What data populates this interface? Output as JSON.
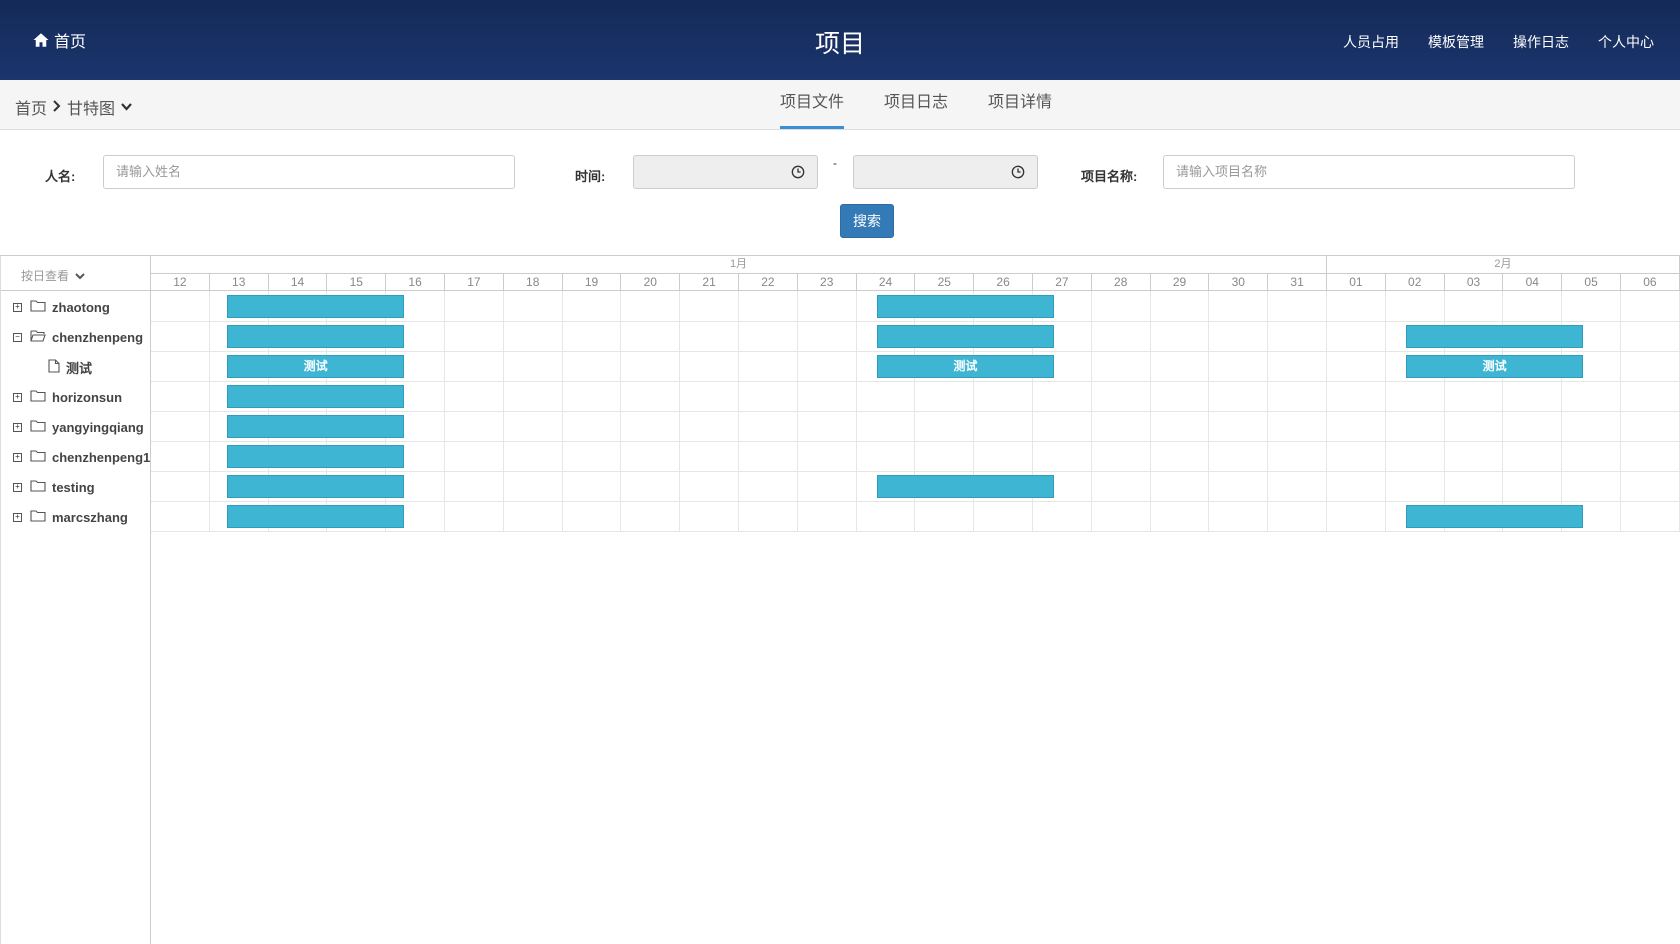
{
  "header": {
    "home_label": "首页",
    "title": "项目",
    "nav": [
      "人员占用",
      "模板管理",
      "操作日志",
      "个人中心"
    ]
  },
  "breadcrumb": {
    "root": "首页",
    "current": "甘特图"
  },
  "tabs": [
    {
      "label": "项目文件",
      "active": true
    },
    {
      "label": "项目日志",
      "active": false
    },
    {
      "label": "项目详情",
      "active": false
    }
  ],
  "filters": {
    "name_label": "人名:",
    "name_placeholder": "请输入姓名",
    "time_label": "时间:",
    "start_value": "",
    "end_value": "",
    "range_separator": "-",
    "project_label": "项目名称:",
    "project_placeholder": "请输入项目名称",
    "search_label": "搜索"
  },
  "gantt": {
    "view_mode": "按日查看",
    "months": [
      {
        "label": "1月",
        "days": [
          "12",
          "13",
          "14",
          "15",
          "16",
          "17",
          "18",
          "19",
          "20",
          "21",
          "22",
          "23",
          "24",
          "25",
          "26",
          "27",
          "28",
          "29",
          "30",
          "31"
        ]
      },
      {
        "label": "2月",
        "days": [
          "01",
          "02",
          "03",
          "04",
          "05",
          "06"
        ]
      }
    ],
    "rows": [
      {
        "name": "zhaotong",
        "type": "folder",
        "expanded": false,
        "level": 0
      },
      {
        "name": "chenzhenpeng",
        "type": "folder",
        "expanded": true,
        "level": 0
      },
      {
        "name": "测试",
        "type": "file",
        "level": 1
      },
      {
        "name": "horizonsun",
        "type": "folder",
        "expanded": false,
        "level": 0
      },
      {
        "name": "yangyingqiang",
        "type": "folder",
        "expanded": false,
        "level": 0
      },
      {
        "name": "chenzhenpeng1",
        "type": "folder",
        "expanded": false,
        "level": 0
      },
      {
        "name": "testing",
        "type": "folder",
        "expanded": false,
        "level": 0
      },
      {
        "name": "marcszhang",
        "type": "folder",
        "expanded": false,
        "level": 0
      }
    ],
    "tasks": [
      {
        "row": 0,
        "start": 1.3,
        "end": 4.3,
        "label": ""
      },
      {
        "row": 0,
        "start": 12.35,
        "end": 15.35,
        "label": ""
      },
      {
        "row": 1,
        "start": 1.3,
        "end": 4.3,
        "label": ""
      },
      {
        "row": 1,
        "start": 12.35,
        "end": 15.35,
        "label": ""
      },
      {
        "row": 1,
        "start": 21.35,
        "end": 24.35,
        "label": ""
      },
      {
        "row": 2,
        "start": 1.3,
        "end": 4.3,
        "label": "测试"
      },
      {
        "row": 2,
        "start": 12.35,
        "end": 15.35,
        "label": "测试"
      },
      {
        "row": 2,
        "start": 21.35,
        "end": 24.35,
        "label": "测试"
      },
      {
        "row": 3,
        "start": 1.3,
        "end": 4.3,
        "label": ""
      },
      {
        "row": 4,
        "start": 1.3,
        "end": 4.3,
        "label": ""
      },
      {
        "row": 5,
        "start": 1.3,
        "end": 4.3,
        "label": ""
      },
      {
        "row": 6,
        "start": 1.3,
        "end": 4.3,
        "label": ""
      },
      {
        "row": 6,
        "start": 12.35,
        "end": 15.35,
        "label": ""
      },
      {
        "row": 7,
        "start": 1.3,
        "end": 4.3,
        "label": ""
      },
      {
        "row": 7,
        "start": 21.35,
        "end": 24.35,
        "label": ""
      }
    ],
    "bar_color": "#3eb6d3"
  }
}
